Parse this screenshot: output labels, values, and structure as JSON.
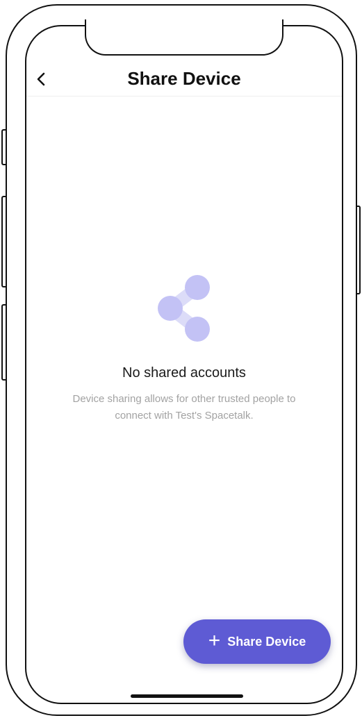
{
  "header": {
    "title": "Share Device",
    "back_icon": "chevron-left-icon"
  },
  "empty_state": {
    "icon": "share-icon",
    "title": "No shared accounts",
    "description": "Device sharing allows for other trusted people to connect with Test's Spacetalk."
  },
  "fab": {
    "icon": "plus-icon",
    "plus_glyph": "+",
    "label": "Share Device"
  },
  "colors": {
    "accent": "#5e5bd4",
    "icon_light": "#c3c2f5",
    "icon_dark": "#a9a7ef",
    "muted_text": "#a2a2a2"
  }
}
